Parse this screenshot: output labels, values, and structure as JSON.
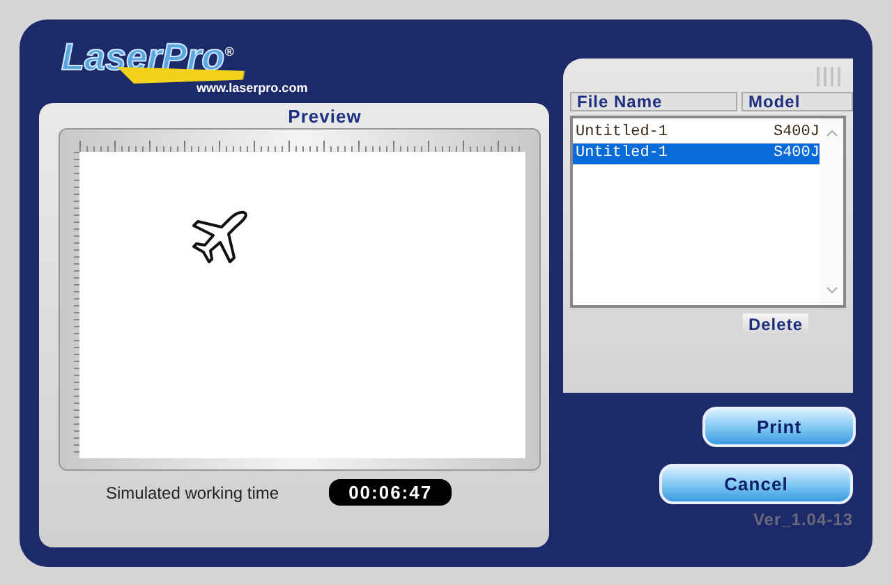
{
  "header": {
    "logo": "LaserPro$^{®}$",
    "url": "www.laserpro.com"
  },
  "preview": {
    "title": "Preview"
  },
  "file_list": {
    "columns": [
      "File Name",
      "Model"
    ],
    "rows": [
      {
        "file_name": "Untitled-1",
        "model": "S400J",
        "selected": false
      },
      {
        "file_name": "Untitled-1",
        "model": "S400J",
        "selected": true
      }
    ]
  },
  "delete_button": "Delete",
  "working_time": {
    "label": "Simulated working time",
    "value": "00:06:47"
  },
  "buttons": [
    "Print",
    "Cancel"
  ],
  "version": "Ver_1.04-13"
}
